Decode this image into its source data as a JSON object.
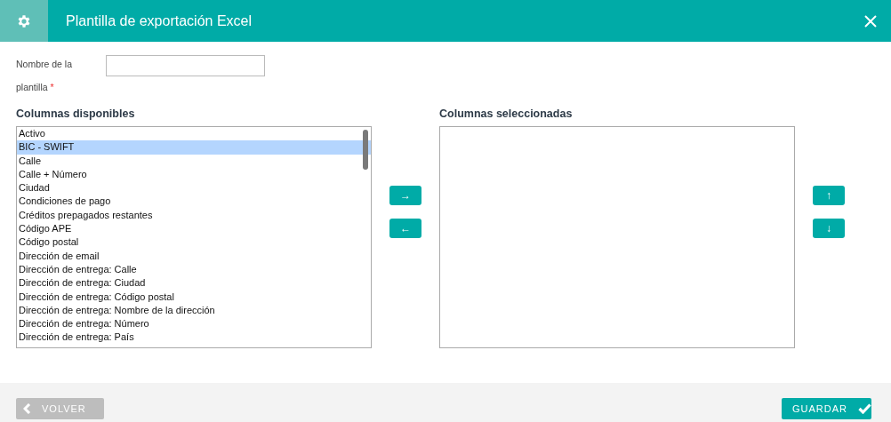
{
  "window": {
    "title": "Plantilla de exportación Excel"
  },
  "template_name": {
    "label": "Nombre de la plantilla",
    "required_mark": "*"
  },
  "available": {
    "title": "Columnas disponibles",
    "items": [
      {
        "label": "Activo",
        "selected": false
      },
      {
        "label": "BIC - SWIFT",
        "selected": true
      },
      {
        "label": "Calle",
        "selected": false
      },
      {
        "label": "Calle + Número",
        "selected": false
      },
      {
        "label": "Ciudad",
        "selected": false
      },
      {
        "label": "Condiciones de pago",
        "selected": false
      },
      {
        "label": "Créditos prepagados restantes",
        "selected": false
      },
      {
        "label": "Código APE",
        "selected": false
      },
      {
        "label": "Código postal",
        "selected": false
      },
      {
        "label": "Dirección de email",
        "selected": false
      },
      {
        "label": "Dirección de entrega: Calle",
        "selected": false
      },
      {
        "label": "Dirección de entrega: Ciudad",
        "selected": false
      },
      {
        "label": "Dirección de entrega: Código postal",
        "selected": false
      },
      {
        "label": "Dirección de entrega: Nombre de la dirección",
        "selected": false
      },
      {
        "label": "Dirección de entrega: Número",
        "selected": false
      },
      {
        "label": "Dirección de entrega: País",
        "selected": false
      }
    ]
  },
  "transfer_buttons": [
    "→",
    "←"
  ],
  "selected_columns": {
    "title": "Columnas seleccionadas"
  },
  "order_buttons": [
    "↑",
    "↓"
  ],
  "footer": {
    "back": "VOLVER",
    "save": "GUARDAR"
  }
}
